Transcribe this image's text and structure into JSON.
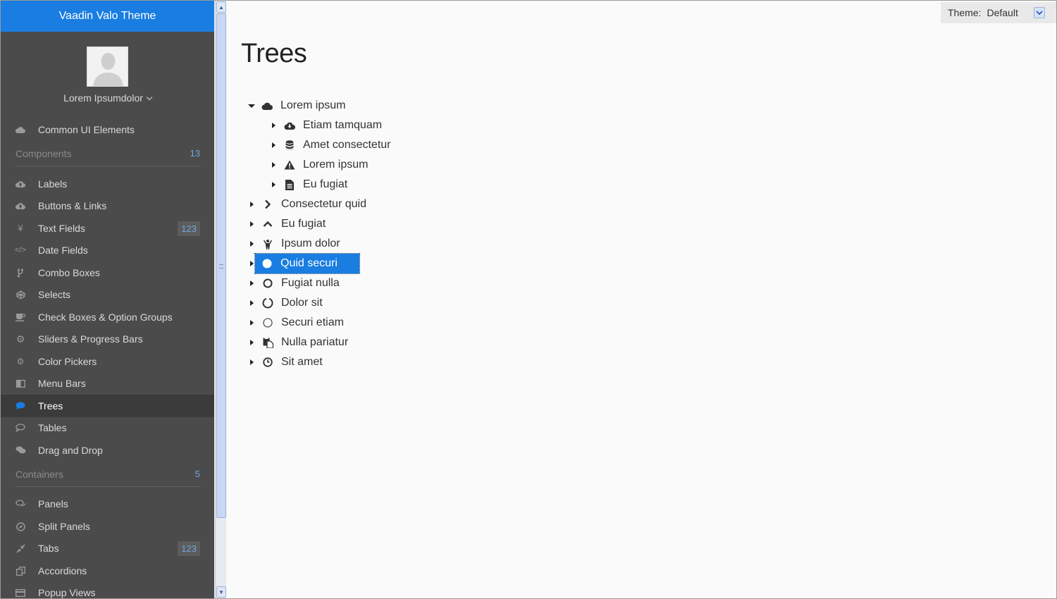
{
  "app": {
    "title": "Vaadin Valo Theme"
  },
  "user": {
    "name": "Lorem Ipsumdolor"
  },
  "menu": {
    "top_item": {
      "label": "Common UI Elements",
      "icon": "cloud-icon"
    },
    "sections": [
      {
        "label": "Components",
        "count": "13"
      },
      {
        "label": "Containers",
        "count": "5"
      }
    ],
    "components": [
      {
        "label": "Labels",
        "icon": "cloud-upload-icon"
      },
      {
        "label": "Buttons & Links",
        "icon": "cloud-upload-icon"
      },
      {
        "label": "Text Fields",
        "icon": "yen-icon",
        "badge": "123"
      },
      {
        "label": "Date Fields",
        "icon": "code-icon"
      },
      {
        "label": "Combo Boxes",
        "icon": "code-fork-icon"
      },
      {
        "label": "Selects",
        "icon": "codepen-icon"
      },
      {
        "label": "Check Boxes & Option Groups",
        "icon": "coffee-icon"
      },
      {
        "label": "Sliders & Progress Bars",
        "icon": "cog-icon"
      },
      {
        "label": "Color Pickers",
        "icon": "cogs-icon"
      },
      {
        "label": "Menu Bars",
        "icon": "columns-icon"
      },
      {
        "label": "Trees",
        "icon": "comment-icon",
        "selected": true
      },
      {
        "label": "Tables",
        "icon": "comment-outline-icon"
      },
      {
        "label": "Drag and Drop",
        "icon": "comments-icon"
      }
    ],
    "containers": [
      {
        "label": "Panels",
        "icon": "comments-outline-icon"
      },
      {
        "label": "Split Panels",
        "icon": "compass-icon"
      },
      {
        "label": "Tabs",
        "icon": "compress-icon",
        "badge": "123"
      },
      {
        "label": "Accordions",
        "icon": "copy-icon"
      },
      {
        "label": "Popup Views",
        "icon": "credit-card-icon"
      }
    ]
  },
  "main": {
    "title": "Trees",
    "theme_select": {
      "label": "Theme:",
      "value": "Default"
    }
  },
  "tree": [
    {
      "label": "Lorem ipsum",
      "icon": "cloud-icon",
      "expanded": true,
      "level": 0
    },
    {
      "label": "Etiam tamquam",
      "icon": "cloud-download-icon",
      "level": 1
    },
    {
      "label": "Amet consectetur",
      "icon": "database-icon",
      "level": 1
    },
    {
      "label": "Lorem ipsum",
      "icon": "warning-icon",
      "level": 1
    },
    {
      "label": "Eu fugiat",
      "icon": "file-text-icon",
      "level": 1
    },
    {
      "label": "Consectetur quid",
      "icon": "chevron-right-icon",
      "level": 0
    },
    {
      "label": "Eu fugiat",
      "icon": "chevron-up-icon",
      "level": 0
    },
    {
      "label": "Ipsum dolor",
      "icon": "child-icon",
      "level": 0
    },
    {
      "label": "Quid securi",
      "icon": "circle-icon",
      "level": 0,
      "selected": true
    },
    {
      "label": "Fugiat nulla",
      "icon": "circle-outline-icon",
      "level": 0
    },
    {
      "label": "Dolor sit",
      "icon": "circle-notch-icon",
      "level": 0
    },
    {
      "label": "Securi etiam",
      "icon": "circle-thin-icon",
      "level": 0
    },
    {
      "label": "Nulla pariatur",
      "icon": "clipboard-icon",
      "level": 0
    },
    {
      "label": "Sit amet",
      "icon": "clock-icon",
      "level": 0
    }
  ],
  "colors": {
    "accent": "#197de1",
    "sidebar_bg": "#4b4b4b",
    "badge_text": "#6fa6de"
  }
}
